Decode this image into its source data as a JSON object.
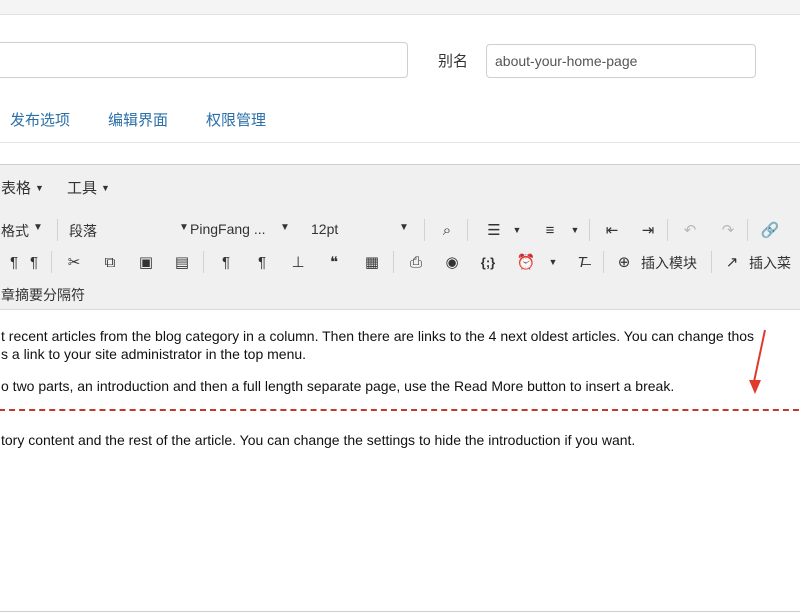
{
  "alias": {
    "label": "别名",
    "value": "about-your-home-page"
  },
  "tabs": [
    "发布选项",
    "编辑界面",
    "权限管理"
  ],
  "menubar": {
    "table": "表格",
    "tools": "工具"
  },
  "toolbar": {
    "formats": "格式",
    "block": "段落",
    "font": "PingFang ...",
    "size": "12pt",
    "insert_module": "插入模块",
    "insert_menu": "插入菜",
    "readmore": "章摘要分隔符"
  },
  "content": {
    "line1": "t recent articles from the blog category in a column. Then there are links to the 4 next oldest articles. You can change thos",
    "line2": "s a link to your site administrator in the top menu.",
    "line3": "o two parts, an introduction and then a full length separate page, use the Read More button to insert a break.",
    "line4": "tory content and the rest of the article. You can change the settings to hide the introduction if you want."
  },
  "colors": {
    "tab_link": "#2a6fa8",
    "readmore_line": "#c0392b",
    "annotation_arrow": "#e03a2c"
  }
}
